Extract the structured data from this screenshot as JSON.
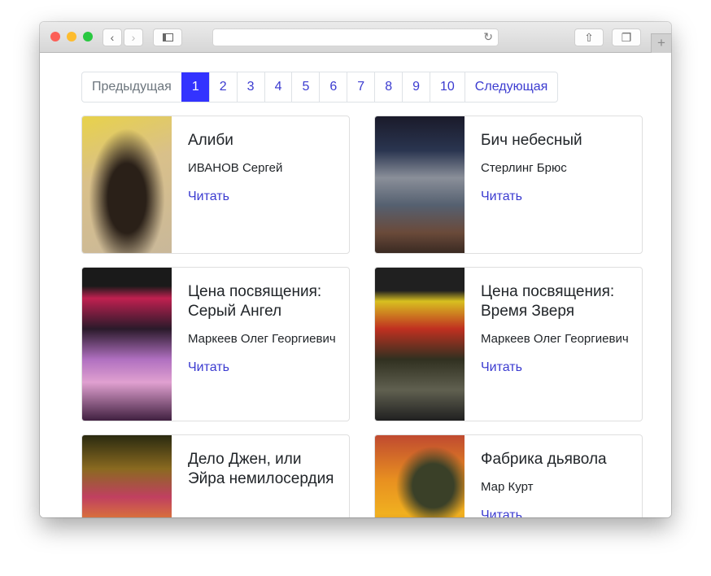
{
  "browser": {
    "back_icon": "chevron-left-icon",
    "forward_icon": "chevron-right-icon",
    "sidebar_icon": "sidebar-icon",
    "reload_icon": "reload-icon",
    "share_icon": "share-icon",
    "tabs_icon": "tabs-icon",
    "new_tab": "+"
  },
  "pagination": {
    "prev": "Предыдущая",
    "pages": [
      "1",
      "2",
      "3",
      "4",
      "5",
      "6",
      "7",
      "8",
      "9",
      "10"
    ],
    "current": "1",
    "next": "Следующая"
  },
  "books": [
    {
      "title": "Алиби",
      "author": "ИВАНОВ Сергей",
      "read": "Читать"
    },
    {
      "title": "Бич небесный",
      "author": "Стерлинг Брюс",
      "read": "Читать"
    },
    {
      "title": "Цена посвящения: Серый Ангел",
      "author": "Маркеев Олег Георгиевич",
      "read": "Читать"
    },
    {
      "title": "Цена посвящения: Время Зверя",
      "author": "Маркеев Олег Георгиевич",
      "read": "Читать"
    },
    {
      "title": "Дело Джен, или Эйра немилосердия"
    },
    {
      "title": "Фабрика дьявола",
      "author": "Мар Курт",
      "read": "Читать"
    }
  ]
}
